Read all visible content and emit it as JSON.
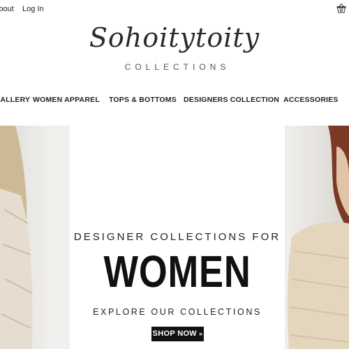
{
  "topbar": {
    "about_label": "About",
    "login_label": "Log In",
    "cart_icon": "basket-icon"
  },
  "logo": {
    "script": "Sohoitytoity",
    "subtitle": "COLLECTIONS"
  },
  "nav": {
    "items": [
      {
        "label": "GALLERY"
      },
      {
        "label": "WOMEN APPAREL"
      },
      {
        "label": "TOPS & BOTTOMS"
      },
      {
        "label": "DESIGNERS COLLECTION"
      },
      {
        "label": "ACCESSORIES"
      }
    ]
  },
  "hero": {
    "line1": "DESIGNER COLLECTIONS FOR",
    "line2": "WOMEN",
    "line3": "EXPLORE OUR COLLECTIONS",
    "cta_label": "SHOP NOW",
    "cta_icon": "double-chevron-right-icon"
  },
  "colors": {
    "text": "#1a1a1a",
    "button_bg": "#111111",
    "button_text": "#ffffff"
  }
}
